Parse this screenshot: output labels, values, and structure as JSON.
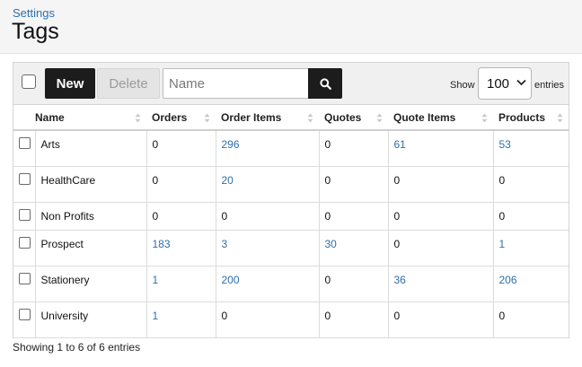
{
  "header": {
    "breadcrumb": "Settings",
    "title": "Tags"
  },
  "toolbar": {
    "new_label": "New",
    "delete_label": "Delete",
    "search_placeholder": "Name",
    "search_value": "",
    "search_icon": "search-icon",
    "show_label": "Show",
    "entries_value": "100",
    "entries_label": "entries"
  },
  "table": {
    "columns": [
      "Name",
      "Orders",
      "Order Items",
      "Quotes",
      "Quote Items",
      "Products"
    ],
    "rows": [
      {
        "name": "Arts",
        "orders": "0",
        "order_items": "296",
        "quotes": "0",
        "quote_items": "61",
        "products": "53"
      },
      {
        "name": "HealthCare",
        "orders": "0",
        "order_items": "20",
        "quotes": "0",
        "quote_items": "0",
        "products": "0"
      },
      {
        "name": "Non Profits",
        "orders": "0",
        "order_items": "0",
        "quotes": "0",
        "quote_items": "0",
        "products": "0"
      },
      {
        "name": "Prospect",
        "orders": "183",
        "order_items": "3",
        "quotes": "30",
        "quote_items": "0",
        "products": "1"
      },
      {
        "name": "Stationery",
        "orders": "1",
        "order_items": "200",
        "quotes": "0",
        "quote_items": "36",
        "products": "206"
      },
      {
        "name": "University",
        "orders": "1",
        "order_items": "0",
        "quotes": "0",
        "quote_items": "0",
        "products": "0"
      }
    ]
  },
  "footer": {
    "info": "Showing 1 to 6 of 6 entries"
  },
  "colors": {
    "link": "#2d6fad",
    "primary_button": "#1c1c1c"
  }
}
